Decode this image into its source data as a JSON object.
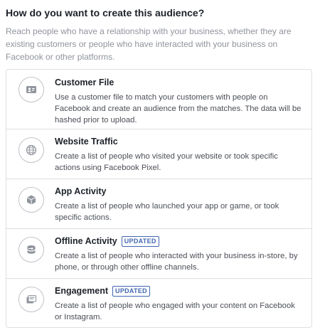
{
  "heading": "How do you want to create this audience?",
  "intro": "Reach people who have a relationship with your business, whether they are existing customers or people who have interacted with your business on Facebook or other platforms.",
  "options": [
    {
      "title": "Customer File",
      "description": "Use a customer file to match your customers with people on Facebook and create an audience from the matches. The data will be hashed prior to upload.",
      "icon": "contact-card-icon",
      "badge": ""
    },
    {
      "title": "Website Traffic",
      "description": "Create a list of people who visited your website or took specific actions using Facebook Pixel.",
      "icon": "globe-icon",
      "badge": ""
    },
    {
      "title": "App Activity",
      "description": "Create a list of people who launched your app or game, or took specific actions.",
      "icon": "cube-icon",
      "badge": ""
    },
    {
      "title": "Offline Activity",
      "description": "Create a list of people who interacted with your business in-store, by phone, or through other offline channels.",
      "icon": "store-icon",
      "badge": "UPDATED"
    },
    {
      "title": "Engagement",
      "description": "Create a list of people who engaged with your content on Facebook or Instagram.",
      "icon": "engagement-icon",
      "badge": "UPDATED"
    }
  ],
  "colors": {
    "badge": "#4267b2",
    "border": "#dddfe2",
    "muted_text": "#90949c",
    "icon": "#90949c"
  }
}
